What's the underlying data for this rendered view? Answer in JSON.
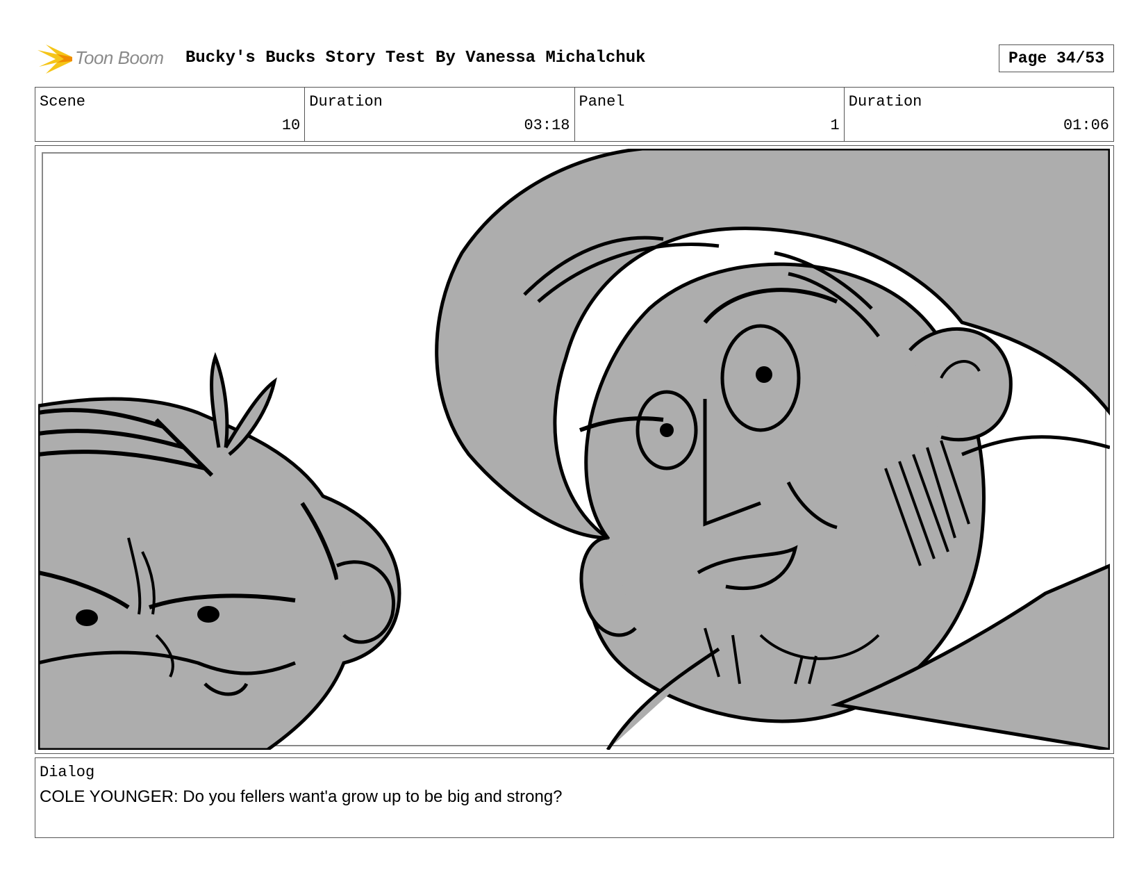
{
  "header": {
    "logo_text": "Toon Boom",
    "title": "Bucky's Bucks Story Test  By Vanessa Michalchuk",
    "page": "Page 34/53"
  },
  "info": {
    "scene_label": "Scene",
    "scene_value": "10",
    "scene_duration_label": "Duration",
    "scene_duration_value": "03:18",
    "panel_label": "Panel",
    "panel_value": "1",
    "panel_duration_label": "Duration",
    "panel_duration_value": "01:06"
  },
  "panel": {
    "image": "storyboard-sketch-two-characters",
    "fill_color": "#adadad",
    "line_color": "#000000"
  },
  "dialog": {
    "label": "Dialog",
    "text": "COLE YOUNGER: Do you fellers want'a grow up to be big and strong?"
  },
  "colors": {
    "logo_accent": "#f5c518",
    "border": "#555555"
  }
}
